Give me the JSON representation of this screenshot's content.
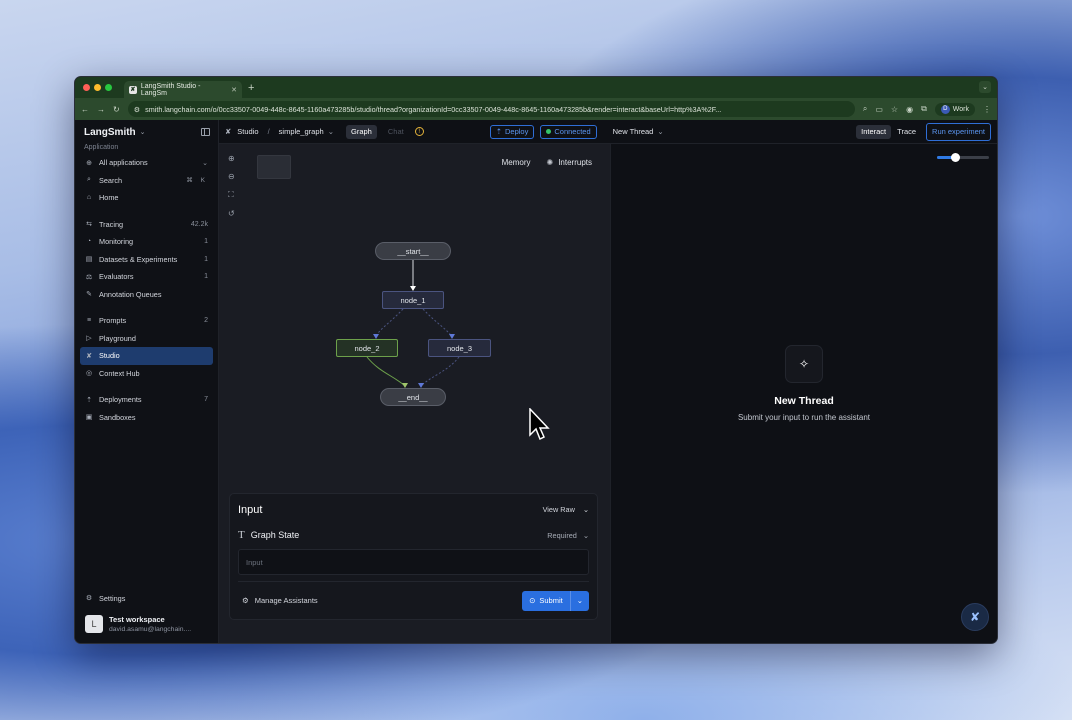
{
  "browser": {
    "tab_title": "LangSmith Studio - LangSm",
    "tab_favicon": "✘",
    "new_tab": "+",
    "url": "smith.langchain.com/o/0cc33507-0049-448c-8645-1160a473285b/studio/thread?organizationId=0cc33507-0049-448c-8645-1160a473285b&render=interact&baseUrl=http%3A%2F...",
    "profile_initial": "D",
    "profile_label": "Work",
    "traffic_colors": [
      "#ff5f57",
      "#febc2e",
      "#28c840"
    ]
  },
  "sidebar": {
    "brand": "LangSmith",
    "section_label": "Application",
    "app_selector": "All applications",
    "search_label": "Search",
    "search_shortcut": "⌘ K",
    "home": "Home",
    "group1": [
      {
        "label": "Tracing",
        "count": "42.2k"
      },
      {
        "label": "Monitoring",
        "count": "1"
      },
      {
        "label": "Datasets & Experiments",
        "count": "1"
      },
      {
        "label": "Evaluators",
        "count": "1"
      },
      {
        "label": "Annotation Queues",
        "count": ""
      }
    ],
    "group2": [
      {
        "label": "Prompts",
        "count": "2"
      },
      {
        "label": "Playground",
        "count": ""
      },
      {
        "label": "Studio",
        "count": ""
      },
      {
        "label": "Context Hub",
        "count": ""
      }
    ],
    "group3": [
      {
        "label": "Deployments",
        "count": "7"
      },
      {
        "label": "Sandboxes",
        "count": ""
      }
    ],
    "settings": "Settings",
    "workspace_initial": "L",
    "workspace_name": "Test workspace",
    "workspace_email": "david.asamu@langchain...."
  },
  "topbar": {
    "studio": "Studio",
    "separator": "/",
    "graph_name": "simple_graph",
    "tab_graph": "Graph",
    "tab_chat": "Chat",
    "deploy": "Deploy",
    "connected": "Connected",
    "new_thread": "New Thread",
    "interact": "Interact",
    "trace": "Trace",
    "run_experiment": "Run experiment"
  },
  "canvas": {
    "memory": "Memory",
    "interrupts": "Interrupts",
    "nodes": {
      "start": "__start__",
      "node_1": "node_1",
      "node_2": "node_2",
      "node_3": "node_3",
      "end": "__end__"
    }
  },
  "input_panel": {
    "title": "Input",
    "view_raw": "View Raw",
    "graph_state": "Graph State",
    "required": "Required",
    "input_placeholder": "Input",
    "manage_assistants": "Manage Assistants",
    "submit": "Submit"
  },
  "thread": {
    "title": "New Thread",
    "subtitle": "Submit your input to run the assistant"
  }
}
